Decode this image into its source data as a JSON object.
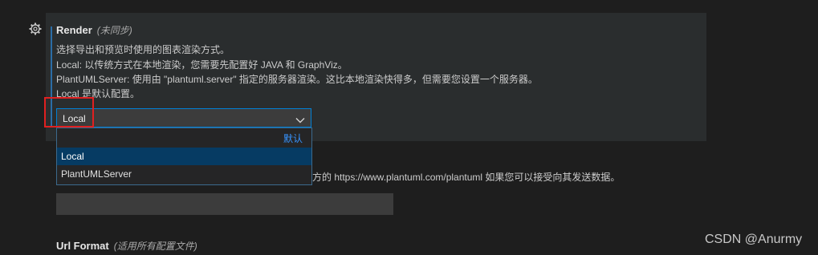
{
  "setting": {
    "title": "Render",
    "scope": "(未同步)",
    "description": [
      "选择导出和预览时使用的图表渲染方式。",
      "Local: 以传统方式在本地渲染，您需要先配置好 JAVA 和 GraphViz。",
      "PlantUMLServer: 使用由 \"plantuml.server\" 指定的服务器渲染。这比本地渲染快得多，但需要您设置一个服务器。",
      "Local 是默认配置。"
    ],
    "select": {
      "value": "Local",
      "default_label": "默认",
      "options": [
        "Local",
        "PlantUMLServer"
      ],
      "selected_index": 0
    }
  },
  "next_setting": {
    "partial_description": "方的 https://www.plantuml.com/plantuml 如果您可以接受向其发送数据。",
    "input_value": ""
  },
  "url_format": {
    "title": "Url Format",
    "scope": "(适用所有配置文件)"
  },
  "watermark": "CSDN @Anurmy",
  "colors": {
    "background": "#1e1e1e",
    "panel": "#2a2d2e",
    "focus_border": "#007fd4",
    "selected_option": "#063b63",
    "default_link": "#3794ff",
    "annotation": "#e02020"
  }
}
